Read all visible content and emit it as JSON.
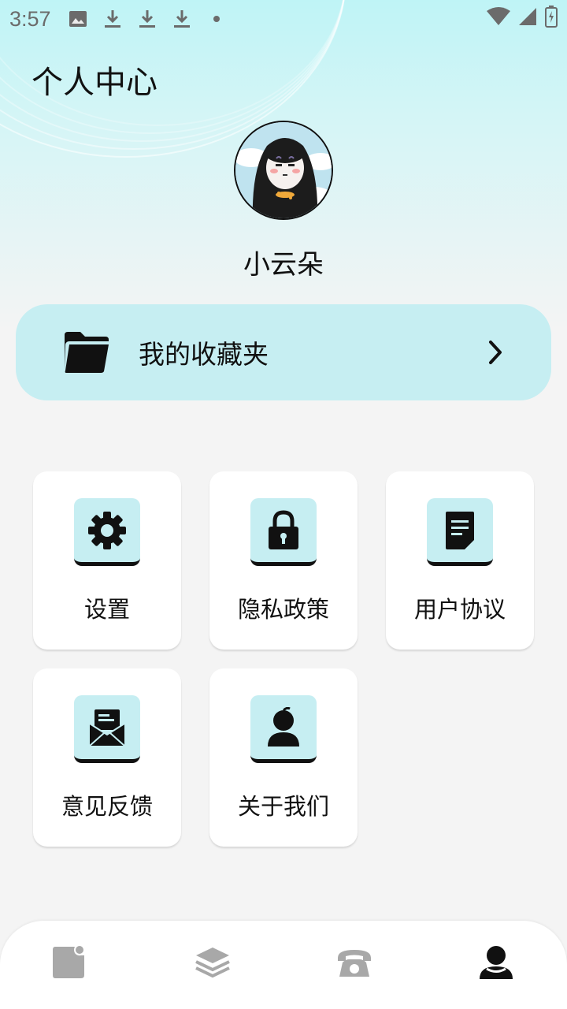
{
  "status_bar": {
    "time": "3:57",
    "icons": [
      "image-icon",
      "download-icon",
      "download-icon",
      "download-icon",
      "dot-icon"
    ],
    "right_icons": [
      "wifi-icon",
      "signal-icon",
      "battery-icon"
    ]
  },
  "header": {
    "title": "个人中心"
  },
  "profile": {
    "username": "小云朵"
  },
  "favorites": {
    "label": "我的收藏夹",
    "icon": "folder-icon"
  },
  "menu": {
    "items": [
      {
        "label": "设置",
        "icon": "gear-icon"
      },
      {
        "label": "隐私政策",
        "icon": "lock-icon"
      },
      {
        "label": "用户协议",
        "icon": "document-icon"
      },
      {
        "label": "意见反馈",
        "icon": "mail-icon"
      },
      {
        "label": "关于我们",
        "icon": "person-icon"
      }
    ]
  },
  "bottom_nav": {
    "items": [
      {
        "icon": "note-icon",
        "active": false
      },
      {
        "icon": "layers-icon",
        "active": false
      },
      {
        "icon": "phone-icon",
        "active": false
      },
      {
        "icon": "profile-icon",
        "active": true
      }
    ]
  },
  "colors": {
    "accent": "#c6eef2",
    "header_gradient_top": "#bff4f6",
    "background": "#f4f4f4",
    "nav_inactive": "#a8a8a8",
    "nav_active": "#111111"
  }
}
